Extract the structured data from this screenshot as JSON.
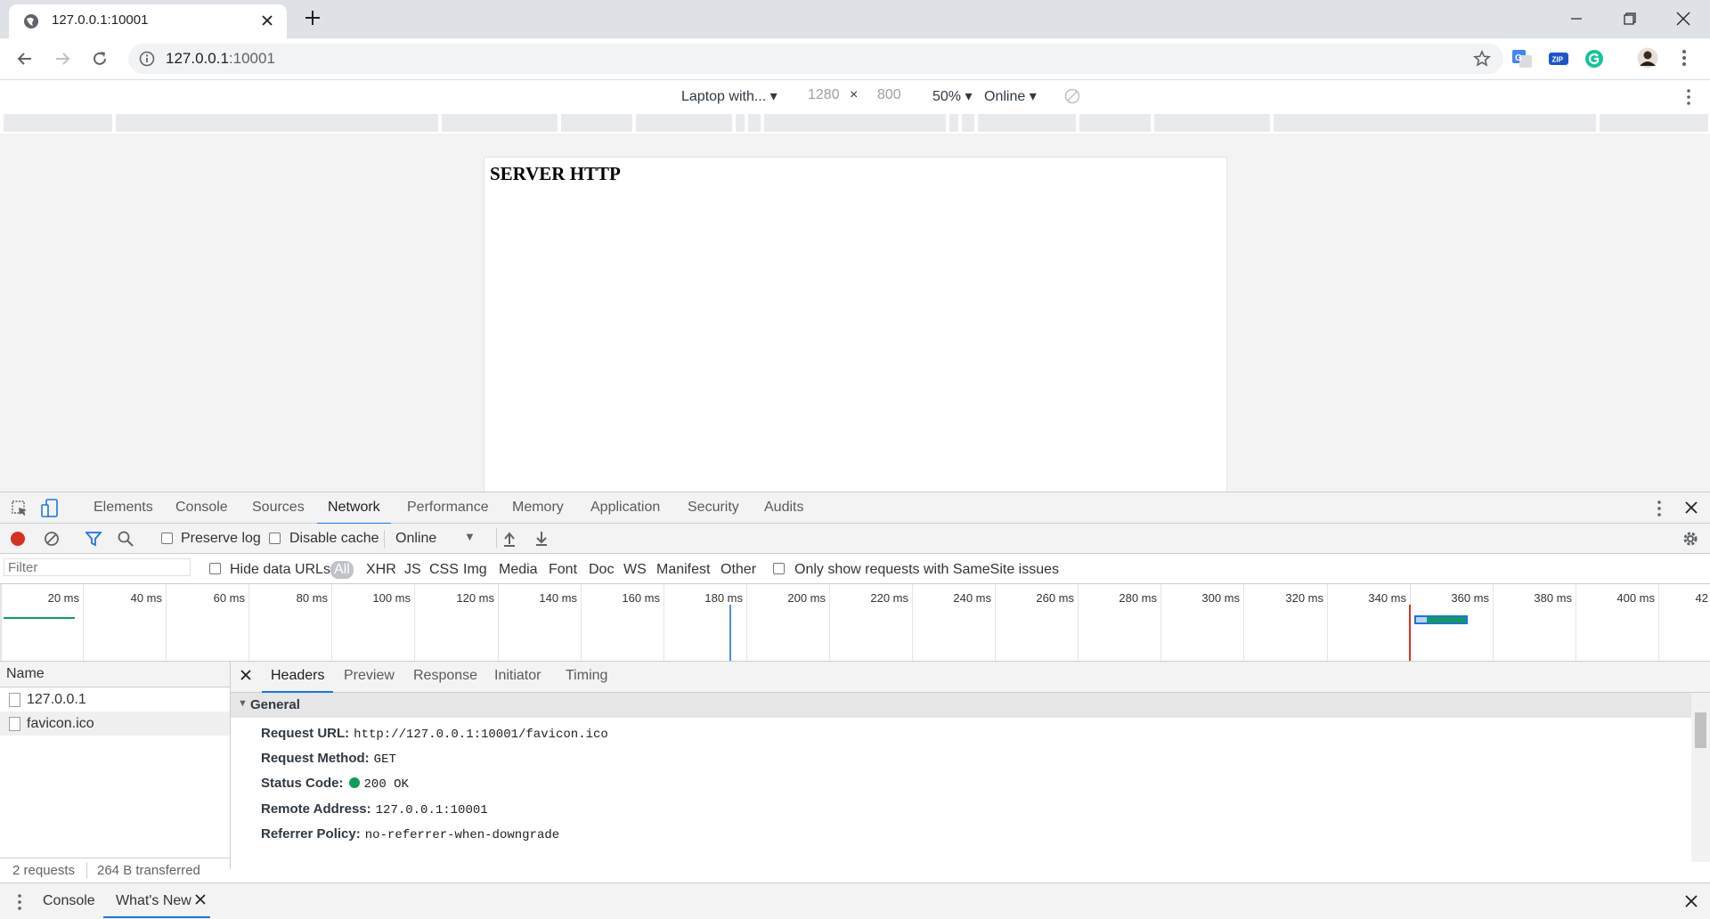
{
  "browser": {
    "tab": {
      "title": "127.0.0.1:10001"
    },
    "url": {
      "host": "127.0.0.1",
      "port": ":10001"
    }
  },
  "device_toolbar": {
    "device": "Laptop with...",
    "width": "1280",
    "times": "×",
    "height": "800",
    "zoom": "50%",
    "throttle": "Online"
  },
  "page": {
    "heading": "SERVER HTTP"
  },
  "devtools": {
    "tabs": [
      "Elements",
      "Console",
      "Sources",
      "Network",
      "Performance",
      "Memory",
      "Application",
      "Security",
      "Audits"
    ],
    "active_tab": "Network",
    "toolbar": {
      "preserve_log": "Preserve log",
      "disable_cache": "Disable cache",
      "throttle": "Online"
    },
    "filter": {
      "placeholder": "Filter",
      "hide_data_urls": "Hide data URLs",
      "types": [
        "All",
        "XHR",
        "JS",
        "CSS",
        "Img",
        "Media",
        "Font",
        "Doc",
        "WS",
        "Manifest",
        "Other"
      ],
      "samesite": "Only show requests with SameSite issues"
    },
    "overview_ticks": [
      "20 ms",
      "40 ms",
      "60 ms",
      "80 ms",
      "100 ms",
      "120 ms",
      "140 ms",
      "160 ms",
      "180 ms",
      "200 ms",
      "220 ms",
      "240 ms",
      "260 ms",
      "280 ms",
      "300 ms",
      "320 ms",
      "340 ms",
      "360 ms",
      "380 ms",
      "400 ms",
      "42"
    ],
    "requests": {
      "header": "Name",
      "rows": [
        "127.0.0.1",
        "favicon.ico"
      ],
      "summary_count": "2 requests",
      "summary_transfer": "264 B transferred"
    },
    "details": {
      "tabs": [
        "Headers",
        "Preview",
        "Response",
        "Initiator",
        "Timing"
      ],
      "section": "General",
      "headers": [
        {
          "key": "Request URL:",
          "value": "http://127.0.0.1:10001/favicon.ico"
        },
        {
          "key": "Request Method:",
          "value": "GET"
        },
        {
          "key": "Status Code:",
          "value": "200 OK"
        },
        {
          "key": "Remote Address:",
          "value": "127.0.0.1:10001"
        },
        {
          "key": "Referrer Policy:",
          "value": "no-referrer-when-downgrade"
        }
      ]
    },
    "drawer": {
      "tabs": [
        "Console",
        "What's New"
      ]
    },
    "colors": {
      "accent": "#1a73e8",
      "record": "#d93025",
      "status_ok": "#0f9d58"
    }
  }
}
